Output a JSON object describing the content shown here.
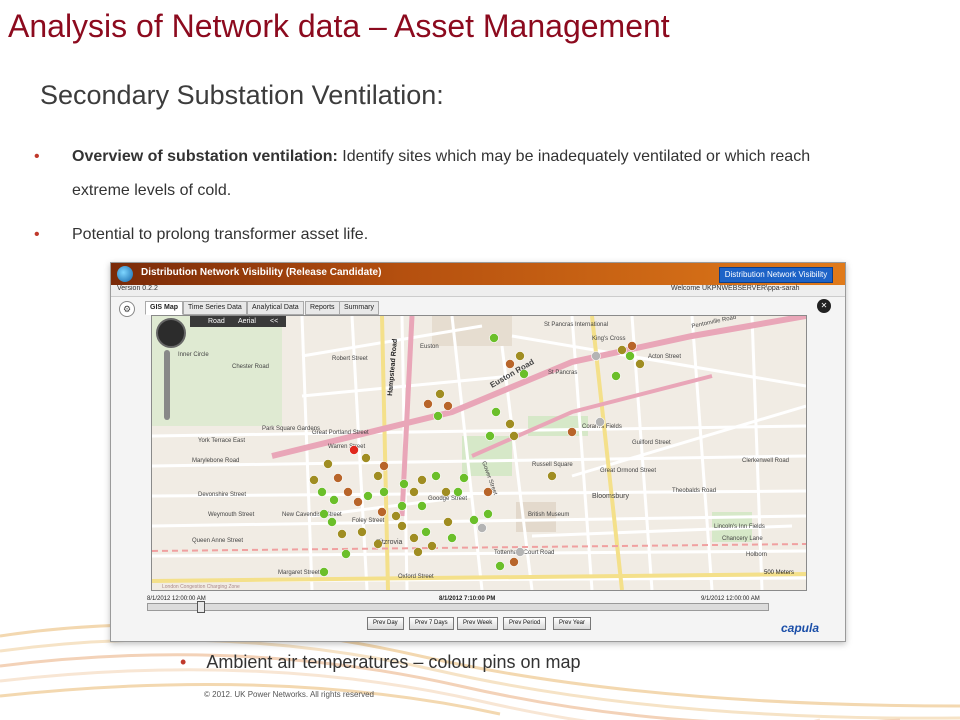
{
  "slide": {
    "title": "Analysis of Network data – Asset Management",
    "subtitle": "Secondary Substation Ventilation:",
    "bullets": [
      {
        "bold": "Overview of substation ventilation:",
        "text": " Identify sites which may be inadequately ventilated or which reach extreme levels of cold."
      },
      {
        "bold": "",
        "text": "Potential to prolong transformer asset life."
      }
    ],
    "bottom_bullet": "Ambient air temperatures – colour pins on map",
    "copyright": "© 2012. UK Power Networks. All rights reserved",
    "colors": {
      "title": "#8c0a1e",
      "bullet": "#c0392b"
    }
  },
  "app": {
    "title": "Distribution Network Visibility (Release Candidate)",
    "badge": "Distribution Network Visibility",
    "version": "Version 0.2.2",
    "welcome": "Welcome UKPNWEBSERVER\\ppa-sarah",
    "tabs": [
      "GIS Map",
      "Time Series Data",
      "Analytical Data",
      "Reports",
      "Summary"
    ],
    "active_tab": "GIS Map",
    "map": {
      "mode_road": "Road",
      "mode_aerial": "Aerial",
      "collapse": "<<",
      "scale": "500 Meters",
      "labels": [
        {
          "text": "Pentonville Road"
        },
        {
          "text": "St Pancras International"
        },
        {
          "text": "King's Cross"
        },
        {
          "text": "Euston Road"
        },
        {
          "text": "Hampstead Road"
        },
        {
          "text": "Euston"
        },
        {
          "text": "St Pancras"
        },
        {
          "text": "Acton Street"
        },
        {
          "text": "Inner Circle"
        },
        {
          "text": "Chester Road"
        },
        {
          "text": "Robert Street"
        },
        {
          "text": "York Terrace East"
        },
        {
          "text": "Park Square Gardens"
        },
        {
          "text": "Marylebone Road"
        },
        {
          "text": "Devonshire Street"
        },
        {
          "text": "Weymouth Street"
        },
        {
          "text": "New Cavendish Street"
        },
        {
          "text": "Queen Anne Street"
        },
        {
          "text": "Margaret Street"
        },
        {
          "text": "Oxford Street"
        },
        {
          "text": "Fitzrovia"
        },
        {
          "text": "Foley Street"
        },
        {
          "text": "Russell Square"
        },
        {
          "text": "Bloomsbury"
        },
        {
          "text": "British Museum"
        },
        {
          "text": "Coram's Fields"
        },
        {
          "text": "Guilford Street"
        },
        {
          "text": "Great Ormond Street"
        },
        {
          "text": "Theobalds Road"
        },
        {
          "text": "Clerkenwell Road"
        },
        {
          "text": "Holborn"
        },
        {
          "text": "Chancery Lane"
        },
        {
          "text": "Lincoln's Inn Fields"
        },
        {
          "text": "Great Portland Street"
        },
        {
          "text": "Warren Street"
        },
        {
          "text": "Goodge Street"
        },
        {
          "text": "Gower Street"
        },
        {
          "text": "Tottenham Court Road"
        },
        {
          "text": "London Congestion Charging Zone"
        }
      ]
    },
    "timeline": {
      "start": "8/1/2012 12:00:00 AM",
      "current": "8/1/2012 7:10:00 PM",
      "end": "9/1/2012 12:00:00 AM",
      "position_fraction": 0.08
    },
    "period_buttons": [
      "Prev Day",
      "Prev 7 Days",
      "Prev Week",
      "Prev Period",
      "Prev Year"
    ],
    "brand": "capula",
    "pin_colors": {
      "green": "#6bbf2a",
      "olive": "#a08d22",
      "brown": "#b8652a",
      "red": "#e0281e",
      "grey": "#b4b4b4"
    }
  }
}
